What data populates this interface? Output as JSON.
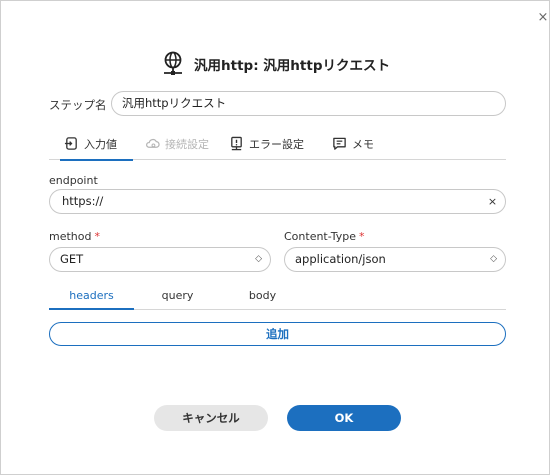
{
  "dialog": {
    "title": "汎用http: 汎用httpリクエスト",
    "title_icon": "globe-network-icon",
    "close_label": "×"
  },
  "step_name": {
    "label": "ステップ名",
    "value": "汎用httpリクエスト"
  },
  "tabs": [
    {
      "label": "入力値",
      "icon": "input-icon",
      "active": true,
      "disabled": false
    },
    {
      "label": "接続設定",
      "icon": "cloud-icon",
      "active": false,
      "disabled": true
    },
    {
      "label": "エラー設定",
      "icon": "warning-monitor-icon",
      "active": false,
      "disabled": false
    },
    {
      "label": "メモ",
      "icon": "memo-icon",
      "active": false,
      "disabled": false
    }
  ],
  "endpoint": {
    "label": "endpoint",
    "value": "https://",
    "clear_label": "×"
  },
  "method": {
    "label": "method",
    "required_mark": "*",
    "value": "GET"
  },
  "content_type": {
    "label": "Content-Type",
    "required_mark": "*",
    "value": "application/json"
  },
  "subtabs": [
    {
      "label": "headers",
      "active": true
    },
    {
      "label": "query",
      "active": false
    },
    {
      "label": "body",
      "active": false
    }
  ],
  "add_button": "追加",
  "footer": {
    "cancel": "キャンセル",
    "ok": "OK"
  },
  "colors": {
    "accent": "#1c6fbf",
    "required": "#dd3333",
    "disabled": "#b5b5b5"
  }
}
